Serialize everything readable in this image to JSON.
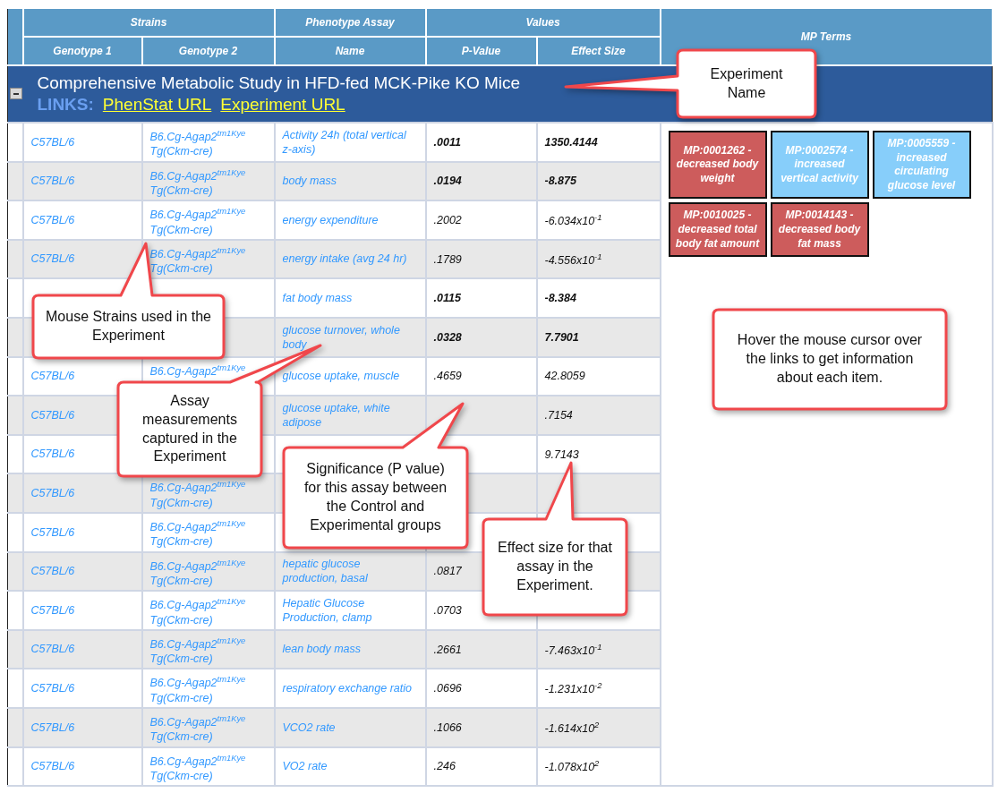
{
  "table": {
    "column_groups": [
      {
        "label": "Strains",
        "columns": [
          "Genotype 1",
          "Genotype 2"
        ]
      },
      {
        "label": "Phenotype Assay",
        "columns": [
          "Name"
        ]
      },
      {
        "label": "Values",
        "columns": [
          "P-Value",
          "Effect Size"
        ]
      },
      {
        "label": "MP Terms"
      }
    ]
  },
  "experiment": {
    "title": "Comprehensive Metabolic Study in HFD-fed MCK-Pike KO Mice",
    "links_label": "LINKS:",
    "links": [
      "PhenStat URL",
      "Experiment URL"
    ],
    "expanded": true
  },
  "rows": [
    {
      "genotype_1": "C57BL/6",
      "genotype_2": "B6.Cg-Agap2$^{tm1Kye}$ Tg(Ckm-cre)",
      "assay": "Activity 24h (total vertical z-axis)",
      "p_value": ".0011",
      "effect_size": "1350.4144",
      "significant": true
    },
    {
      "genotype_1": "C57BL/6",
      "genotype_2": "B6.Cg-Agap2$^{tm1Kye}$ Tg(Ckm-cre)",
      "assay": "body mass",
      "p_value": ".0194",
      "effect_size": "-8.875",
      "significant": true
    },
    {
      "genotype_1": "C57BL/6",
      "genotype_2": "B6.Cg-Agap2$^{tm1Kye}$ Tg(Ckm-cre)",
      "assay": "energy expenditure",
      "p_value": ".2002",
      "effect_size": "-6.034x10$^{-1}$",
      "significant": false
    },
    {
      "genotype_1": "C57BL/6",
      "genotype_2": "B6.Cg-Agap2$^{tm1Kye}$ Tg(Ckm-cre)",
      "assay": "energy intake (avg 24 hr)",
      "p_value": ".1789",
      "effect_size": "-4.556x10$^{-1}$",
      "significant": false
    },
    {
      "assay": "fat body mass",
      "p_value": ".0115",
      "effect_size": "-8.384",
      "significant": true
    },
    {
      "assay": "glucose turnover, whole body",
      "p_value": ".0328",
      "effect_size": "7.7901",
      "significant": true
    },
    {
      "genotype_1": "C57BL/6",
      "genotype_2": "B6.Cg-Agap2$^{tm1Kye}$",
      "assay": "glucose uptake, muscle",
      "p_value": ".4659",
      "effect_size": "42.8059",
      "significant": false
    },
    {
      "genotype_1": "C57BL/6",
      "assay": "glucose uptake, white adipose",
      "effect_size": ".7154",
      "significant": false
    },
    {
      "genotype_1": "C57BL/6",
      "effect_size": "9.7143",
      "significant": false
    },
    {
      "genotype_1": "C57BL/6",
      "genotype_2": "B6.Cg-Agap2$^{tm1Kye}$ Tg(Ckm-cre)"
    },
    {
      "genotype_1": "C57BL/6",
      "genotype_2": "B6.Cg-Agap2$^{tm1Kye}$ Tg(Ckm-cre)"
    },
    {
      "genotype_1": "C57BL/6",
      "genotype_2": "B6.Cg-Agap2$^{tm1Kye}$ Tg(Ckm-cre)",
      "assay": "hepatic glucose production, basal",
      "p_value": ".0817",
      "significant": false
    },
    {
      "genotype_1": "C57BL/6",
      "genotype_2": "B6.Cg-Agap2$^{tm1Kye}$ Tg(Ckm-cre)",
      "assay": "Hepatic Glucose Production, clamp",
      "p_value": ".0703",
      "significant": false
    },
    {
      "genotype_1": "C57BL/6",
      "genotype_2": "B6.Cg-Agap2$^{tm1Kye}$ Tg(Ckm-cre)",
      "assay": "lean body mass",
      "p_value": ".2661",
      "effect_size": "-7.463x10$^{-1}$",
      "significant": false
    },
    {
      "genotype_1": "C57BL/6",
      "genotype_2": "B6.Cg-Agap2$^{tm1Kye}$ Tg(Ckm-cre)",
      "assay": "respiratory exchange ratio",
      "p_value": ".0696",
      "effect_size": "-1.231x10$^{-2}$",
      "significant": false
    },
    {
      "genotype_1": "C57BL/6",
      "genotype_2": "B6.Cg-Agap2$^{tm1Kye}$ Tg(Ckm-cre)",
      "assay": "VCO2 rate",
      "p_value": ".1066",
      "effect_size": "-1.614x10$^{2}$",
      "significant": false
    },
    {
      "genotype_1": "C57BL/6",
      "genotype_2": "B6.Cg-Agap2$^{tm1Kye}$ Tg(Ckm-cre)",
      "assay": "VO2 rate",
      "p_value": ".246",
      "effect_size": "-1.078x10$^{2}$",
      "significant": false
    }
  ],
  "mp_terms": [
    {
      "label": "MP:0001262 - decreased body weight",
      "color": "#cd5c5c"
    },
    {
      "label": "MP:0002574 - increased vertical activity",
      "color": "#87cefa"
    },
    {
      "label": "MP:0005559 - increased circulating glucose level",
      "color": "#87cefa"
    },
    {
      "label": "MP:0010025 - decreased total body fat amount",
      "color": "#cd5c5c"
    },
    {
      "label": "MP:0014143 - decreased body fat mass",
      "color": "#cd5c5c"
    }
  ],
  "callouts": [
    {
      "text": "Experiment Name"
    },
    {
      "text": "Mouse Strains used in the Experiment"
    },
    {
      "text": "Assay measurements captured in the Experiment"
    },
    {
      "text": "Significance (P value) for this assay between the Control and Experimental groups"
    },
    {
      "text": "Effect size for that assay in the Experiment."
    },
    {
      "text": "Hover the mouse cursor over the links to get information about each item."
    }
  ]
}
